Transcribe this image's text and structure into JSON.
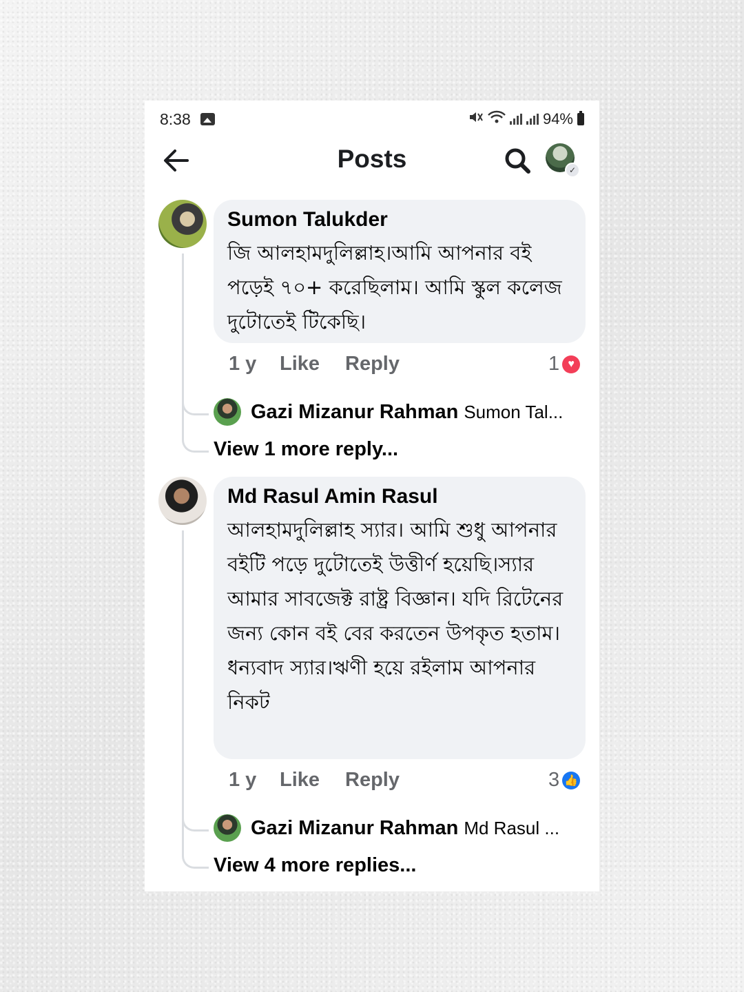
{
  "status_bar": {
    "time": "8:38",
    "battery": "94%"
  },
  "header": {
    "title": "Posts"
  },
  "comments": [
    {
      "author": "Sumon Talukder",
      "text": "জি আলহামদুলিল্লাহ।আমি আপনার বই পড়েই ৭০+ করেছিলাম। আমি স্কুল কলেজ দুটোতেই টিকেছি।",
      "time": "1 y",
      "like_label": "Like",
      "reply_label": "Reply",
      "reaction_count": "1",
      "reaction_type": "love",
      "reply_preview": {
        "name": "Gazi Mizanur Rahman",
        "text": "Sumon Tal..."
      },
      "view_more": "View 1 more reply..."
    },
    {
      "author": "Md Rasul Amin Rasul",
      "text": "আলহামদুলিল্লাহ স্যার। আমি শুধু আপনার বইটি পড়ে দুটোতেই উত্তীর্ণ হয়েছি।স্যার আমার সাবজেক্ট রাষ্ট্র বিজ্ঞান। যদি রিটেনের জন্য কোন বই বের করতেন উপকৃত হতাম।ধন্যবাদ স্যার।ঋণী হয়ে রইলাম আপনার নিকট",
      "time": "1 y",
      "like_label": "Like",
      "reply_label": "Reply",
      "reaction_count": "3",
      "reaction_type": "like",
      "reply_preview": {
        "name": "Gazi Mizanur Rahman",
        "text": "Md Rasul ..."
      },
      "view_more": "View 4 more replies..."
    }
  ],
  "colors": {
    "love": "#f33e58",
    "like": "#1877f2",
    "bubble": "#f0f2f5",
    "meta": "#65676b"
  }
}
